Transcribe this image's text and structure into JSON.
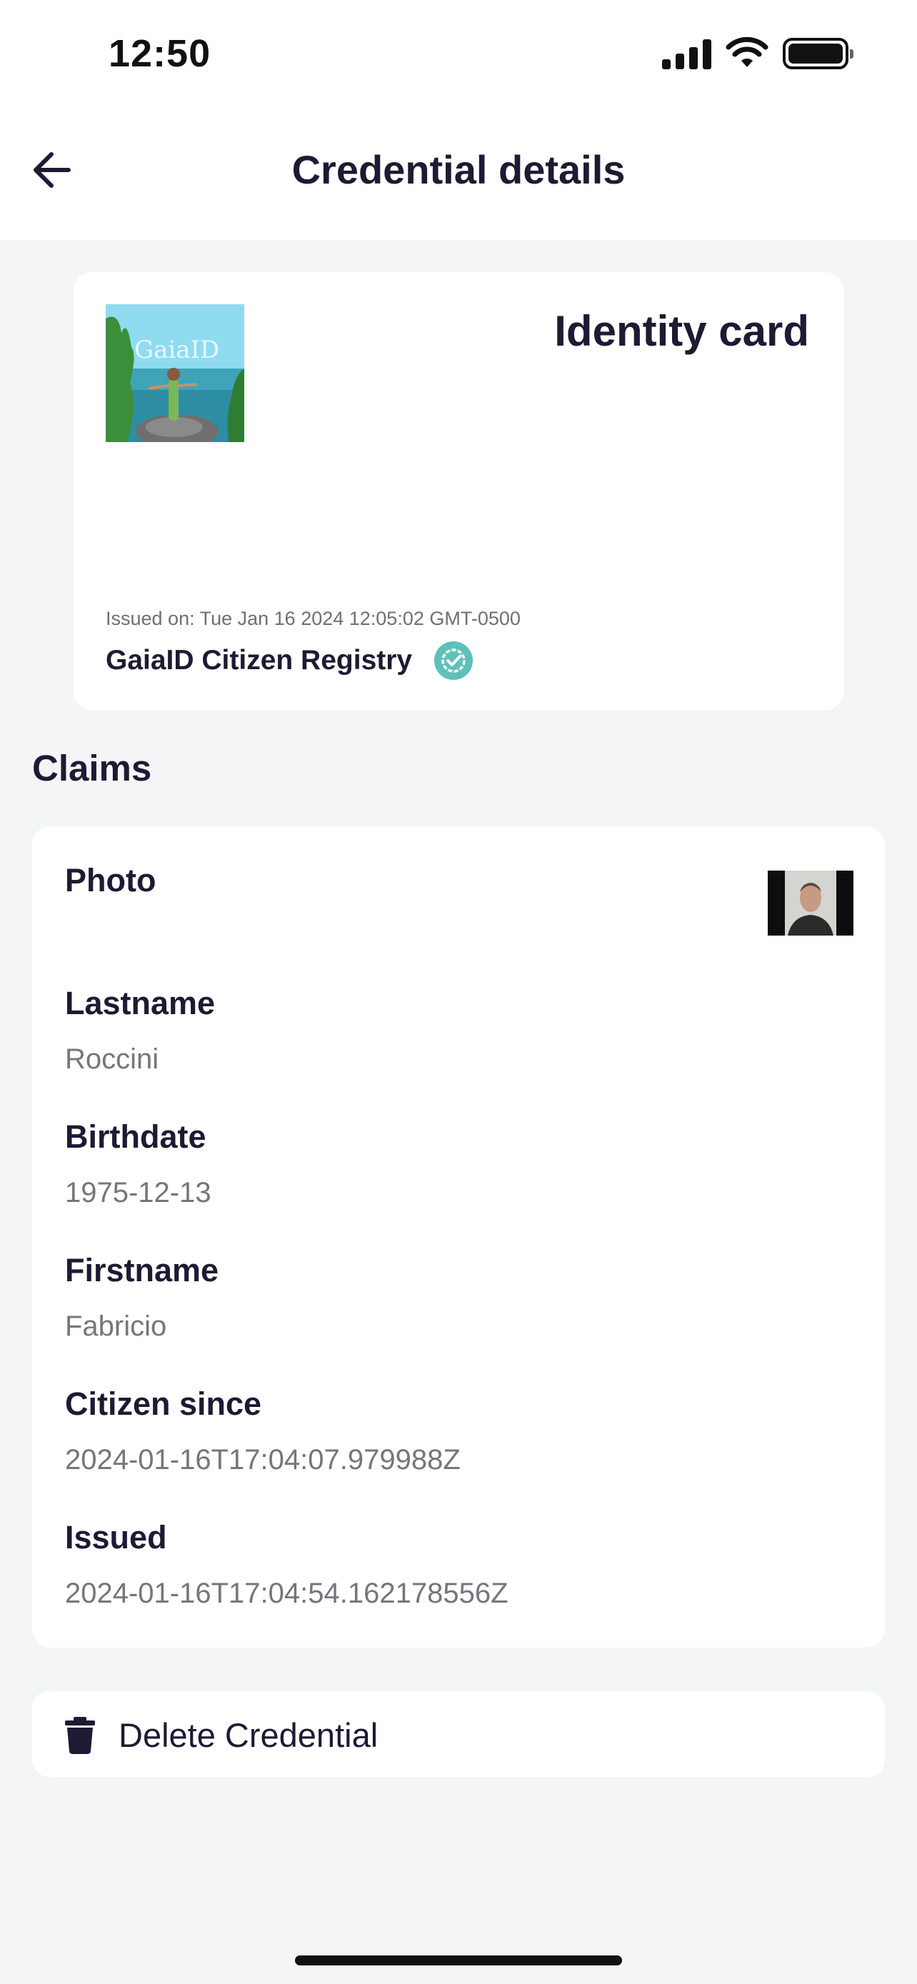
{
  "status_bar": {
    "time": "12:50"
  },
  "header": {
    "title": "Credential details"
  },
  "credential": {
    "type": "Identity card",
    "logo_text": "GaiaID",
    "issued_on": "Issued on: Tue Jan 16 2024 12:05:02 GMT-0500",
    "issuer": "GaiaID Citizen Registry",
    "verified_color": "#5ec1b9"
  },
  "claims": {
    "heading": "Claims",
    "items": [
      {
        "label": "Photo",
        "value": ""
      },
      {
        "label": "Lastname",
        "value": "Roccini"
      },
      {
        "label": "Birthdate",
        "value": "1975-12-13"
      },
      {
        "label": "Firstname",
        "value": "Fabricio"
      },
      {
        "label": "Citizen since",
        "value": "2024-01-16T17:04:07.979988Z"
      },
      {
        "label": "Issued",
        "value": "2024-01-16T17:04:54.162178556Z"
      }
    ]
  },
  "actions": {
    "delete_label": "Delete Credential"
  }
}
